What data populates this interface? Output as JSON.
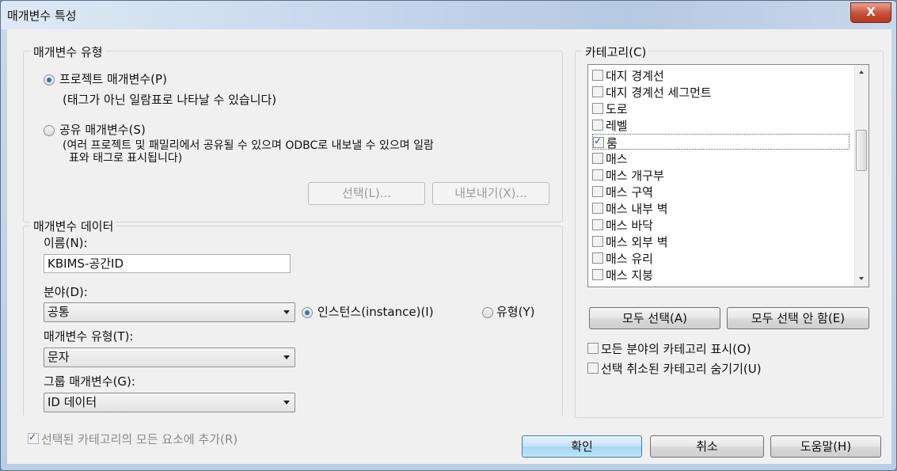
{
  "window": {
    "title": "매개변수 특성",
    "close_label": "X"
  },
  "param_type": {
    "legend": "매개변수 유형",
    "project": {
      "label": "프로젝트 매개변수(P)",
      "desc": "(태그가 아닌 일람표로 나타날 수 있습니다)",
      "selected": true
    },
    "shared": {
      "label": "공유 매개변수(S)",
      "desc_line1": "(여러 프로젝트 및 패밀리에서 공유될 수 있으며 ODBC로 내보낼 수 있으며 일람",
      "desc_line2": "표와 태그로 표시됩니다)",
      "selected": false
    },
    "select_button": "선택(L)...",
    "export_button": "내보내기(X)..."
  },
  "param_data": {
    "legend": "매개변수 데이터",
    "name_label": "이름(N):",
    "name_value": "KBIMS-공간ID",
    "discipline_label": "분야(D):",
    "discipline_value": "공통",
    "instance_label": "인스턴스(instance)(I)",
    "type_label": "유형(Y)",
    "instance_selected": true,
    "param_type_label": "매개변수 유형(T):",
    "param_type_value": "문자",
    "group_label": "그룹 매개변수(G):",
    "group_value": "ID 데이터"
  },
  "category": {
    "legend": "카테고리(C)",
    "items": [
      {
        "label": "대지 경계선",
        "checked": false
      },
      {
        "label": "대지 경계선 세그먼트",
        "checked": false
      },
      {
        "label": "도로",
        "checked": false
      },
      {
        "label": "레벨",
        "checked": false
      },
      {
        "label": "룸",
        "checked": true
      },
      {
        "label": "매스",
        "checked": false
      },
      {
        "label": "매스 개구부",
        "checked": false
      },
      {
        "label": "매스 구역",
        "checked": false
      },
      {
        "label": "매스 내부 벽",
        "checked": false
      },
      {
        "label": "매스 바닥",
        "checked": false
      },
      {
        "label": "매스 외부 벽",
        "checked": false
      },
      {
        "label": "매스 유리",
        "checked": false
      },
      {
        "label": "매스 지붕",
        "checked": false
      }
    ],
    "select_all": "모두 선택(A)",
    "select_none": "모두 선택 안 함(E)",
    "show_all_disciplines": "모든 분야의 카테고리 표시(O)",
    "hide_unchecked": "선택 취소된 카테고리 숨기기(U)"
  },
  "footer": {
    "add_to_all": "선택된 카테고리의 모든 요소에 추가(R)",
    "ok": "확인",
    "cancel": "취소",
    "help": "도움말(H)"
  }
}
